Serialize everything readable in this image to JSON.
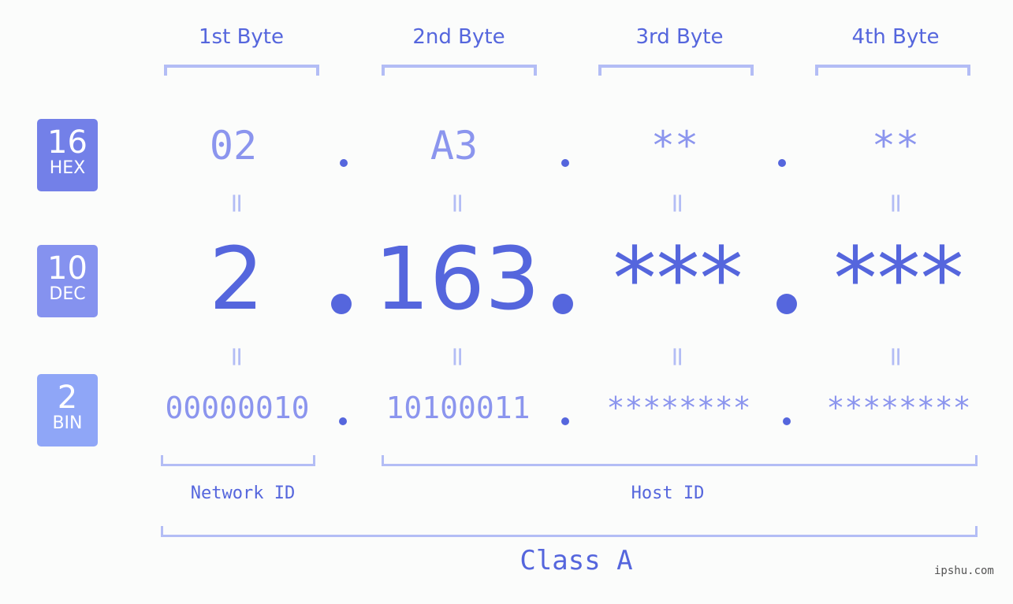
{
  "bytes": [
    {
      "label": "1st Byte",
      "hex": "02",
      "dec": "2",
      "bin": "00000010"
    },
    {
      "label": "2nd Byte",
      "hex": "A3",
      "dec": "163",
      "bin": "10100011"
    },
    {
      "label": "3rd Byte",
      "hex": "**",
      "dec": "***",
      "bin": "********"
    },
    {
      "label": "4th Byte",
      "hex": "**",
      "dec": "***",
      "bin": "********"
    }
  ],
  "badges": {
    "hex": {
      "num": "16",
      "label": "HEX",
      "color": "#7380e8"
    },
    "dec": {
      "num": "10",
      "label": "DEC",
      "color": "#8592ef"
    },
    "bin": {
      "num": "2",
      "label": "BIN",
      "color": "#8fa6f7"
    }
  },
  "equals_symbol": "=",
  "network_id_label": "Network ID",
  "host_id_label": "Host ID",
  "class_label": "Class A",
  "watermark": "ipshu.com"
}
